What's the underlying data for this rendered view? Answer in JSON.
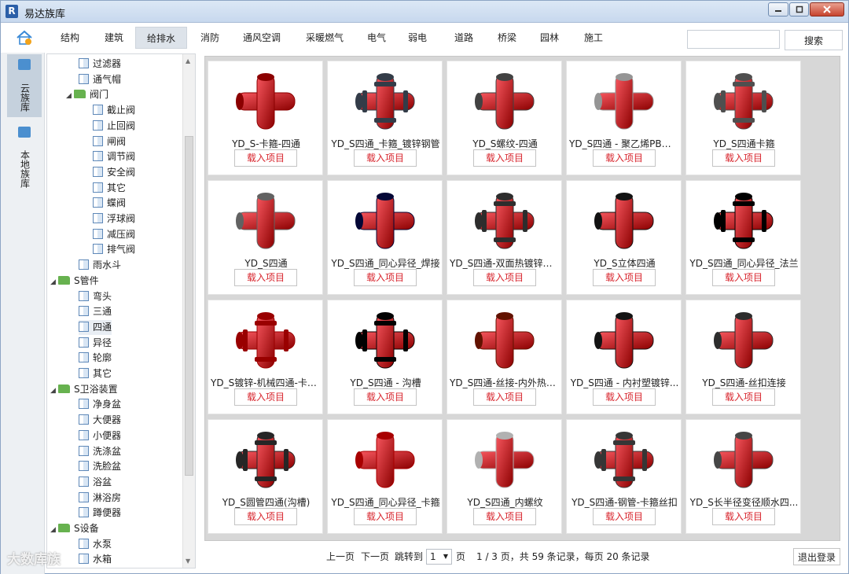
{
  "window": {
    "title": "易达族库",
    "app_icon": "R"
  },
  "categories": [
    "结构",
    "建筑",
    "给排水",
    "消防",
    "通风空调",
    "采暖燃气",
    "电气",
    "弱电",
    "道路",
    "桥梁",
    "园林",
    "施工"
  ],
  "active_category": "给排水",
  "search": {
    "placeholder": "",
    "button": "搜索"
  },
  "left_nav": [
    {
      "label": "云族库",
      "icon": "cloud-icon",
      "active": true
    },
    {
      "label": "本地族库",
      "icon": "local-icon",
      "active": false
    }
  ],
  "tree": [
    {
      "label": "过滤器",
      "type": "file",
      "level": 2
    },
    {
      "label": "通气帽",
      "type": "file",
      "level": 2
    },
    {
      "label": "阀门",
      "type": "folder",
      "level": 2,
      "expanded": true
    },
    {
      "label": "截止阀",
      "type": "file",
      "level": 3
    },
    {
      "label": "止回阀",
      "type": "file",
      "level": 3
    },
    {
      "label": "闸阀",
      "type": "file",
      "level": 3
    },
    {
      "label": "调节阀",
      "type": "file",
      "level": 3
    },
    {
      "label": "安全阀",
      "type": "file",
      "level": 3
    },
    {
      "label": "其它",
      "type": "file",
      "level": 3
    },
    {
      "label": "蝶阀",
      "type": "file",
      "level": 3
    },
    {
      "label": "浮球阀",
      "type": "file",
      "level": 3
    },
    {
      "label": "减压阀",
      "type": "file",
      "level": 3
    },
    {
      "label": "排气阀",
      "type": "file",
      "level": 3
    },
    {
      "label": "雨水斗",
      "type": "file",
      "level": 2
    },
    {
      "label": "S管件",
      "type": "folder",
      "level": 1,
      "expanded": true
    },
    {
      "label": "弯头",
      "type": "file",
      "level": 2
    },
    {
      "label": "三通",
      "type": "file",
      "level": 2
    },
    {
      "label": "四通",
      "type": "file",
      "level": 2,
      "selected": true
    },
    {
      "label": "异径",
      "type": "file",
      "level": 2
    },
    {
      "label": "轮廓",
      "type": "file",
      "level": 2
    },
    {
      "label": "其它",
      "type": "file",
      "level": 2
    },
    {
      "label": "S卫浴装置",
      "type": "folder",
      "level": 1,
      "expanded": true
    },
    {
      "label": "净身盆",
      "type": "file",
      "level": 2
    },
    {
      "label": "大便器",
      "type": "file",
      "level": 2
    },
    {
      "label": "小便器",
      "type": "file",
      "level": 2
    },
    {
      "label": "洗涤盆",
      "type": "file",
      "level": 2
    },
    {
      "label": "洗脸盆",
      "type": "file",
      "level": 2
    },
    {
      "label": "浴盆",
      "type": "file",
      "level": 2
    },
    {
      "label": "淋浴房",
      "type": "file",
      "level": 2
    },
    {
      "label": "蹲便器",
      "type": "file",
      "level": 2
    },
    {
      "label": "S设备",
      "type": "folder",
      "level": 1,
      "expanded": true
    },
    {
      "label": "水泵",
      "type": "file",
      "level": 2
    },
    {
      "label": "水箱",
      "type": "file",
      "level": 2
    }
  ],
  "load_label": "载入项目",
  "items": [
    {
      "name": "YD_S-卡箍-四通",
      "color": "#b3121a",
      "style": "cross"
    },
    {
      "name": "YD_S四通_卡箍_镀锌钢管",
      "color": "#5b6470",
      "style": "clamp"
    },
    {
      "name": "YD_S螺纹-四通",
      "color": "#6a6a6a",
      "style": "cross"
    },
    {
      "name": "YD_S四通 - 聚乙烯PB管...",
      "color": "#bdbdbd",
      "style": "cross"
    },
    {
      "name": "YD_S四通卡箍",
      "color": "#777777",
      "style": "clamp"
    },
    {
      "name": "YD_S四通",
      "color": "#8a8a8a",
      "style": "cross"
    },
    {
      "name": "YD_S四通_同心异径_焊接",
      "color": "#2c2f5e",
      "style": "cross"
    },
    {
      "name": "YD_S四通-双面热镀锌钢...",
      "color": "#555555",
      "style": "clamp"
    },
    {
      "name": "YD_S立体四通",
      "color": "#3a3a3a",
      "style": "cross"
    },
    {
      "name": "YD_S四通_同心异径_法兰",
      "color": "#1f1f1f",
      "style": "clamp"
    },
    {
      "name": "YD_S镀锌-机械四通-卡箍...",
      "color": "#c11a1a",
      "style": "clamp"
    },
    {
      "name": "YD_S四通 - 沟槽",
      "color": "#2a2a2a",
      "style": "clamp"
    },
    {
      "name": "YD_S四通-丝接-内外热浸...",
      "color": "#8a3a1c",
      "style": "cross"
    },
    {
      "name": "YD_S四通 - 内衬塑镀锌...",
      "color": "#3c3c3c",
      "style": "cross"
    },
    {
      "name": "YD_S四通-丝扣连接",
      "color": "#555555",
      "style": "cross"
    },
    {
      "name": "YD_S圆管四通(沟槽)",
      "color": "#4e4e4e",
      "style": "clamp"
    },
    {
      "name": "YD_S四通_同心异径_卡箍",
      "color": "#d01515",
      "style": "cross"
    },
    {
      "name": "YD_S四通_内螺纹",
      "color": "#d9d9d9",
      "style": "cross"
    },
    {
      "name": "YD_S四通-钢管-卡箍丝扣",
      "color": "#5e5e5e",
      "style": "clamp"
    },
    {
      "name": "YD_S长半径变径顺水四...",
      "color": "#6e6e6e",
      "style": "cross"
    }
  ],
  "pager": {
    "prev": "上一页",
    "next": "下一页",
    "goto": "跳转到",
    "page_value": "1",
    "page_unit": "页",
    "info": "1 / 3 页，共 59 条记录，每页 20 条记录"
  },
  "logout": "退出登录",
  "watermark": "大数库族"
}
